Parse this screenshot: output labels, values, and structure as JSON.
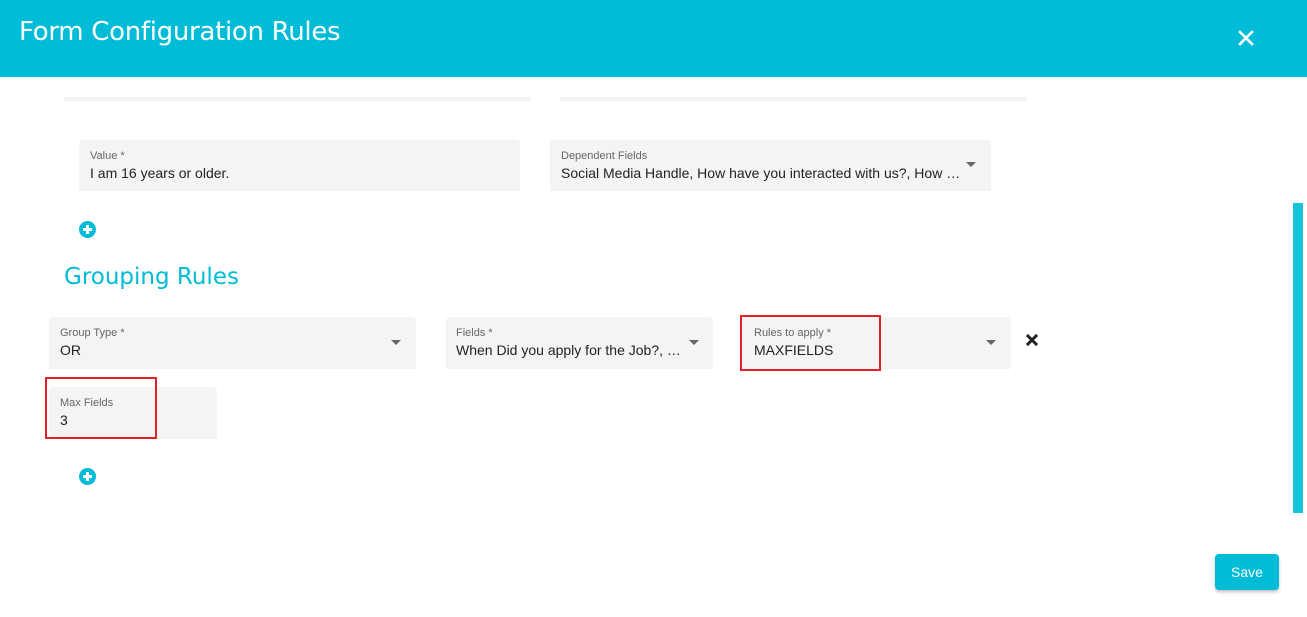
{
  "header": {
    "title": "Form Configuration Rules",
    "close_icon": "close-icon"
  },
  "dependency_rule": {
    "value_field": {
      "label": "Value *",
      "value": "I am 16 years or older."
    },
    "dependent_fields": {
      "label": "Dependent Fields",
      "value": "Social Media Handle, How have you interacted with us?, How are you related to us?"
    },
    "add_icon": "add-circle-icon"
  },
  "grouping_rules": {
    "title": "Grouping Rules",
    "group_type": {
      "label": "Group Type *",
      "value": "OR"
    },
    "fields": {
      "label": "Fields *",
      "value": "When Did you apply for the Job?, Social Media Handle"
    },
    "rules_to_apply": {
      "label": "Rules to apply *",
      "value": "MAXFIELDS"
    },
    "max_fields": {
      "label": "Max Fields",
      "value": "3"
    },
    "remove_icon": "remove-x-icon",
    "add_icon": "add-circle-icon"
  },
  "footer": {
    "save_label": "Save"
  },
  "colors": {
    "accent": "#00bcd6",
    "highlight": "#e0202a"
  }
}
